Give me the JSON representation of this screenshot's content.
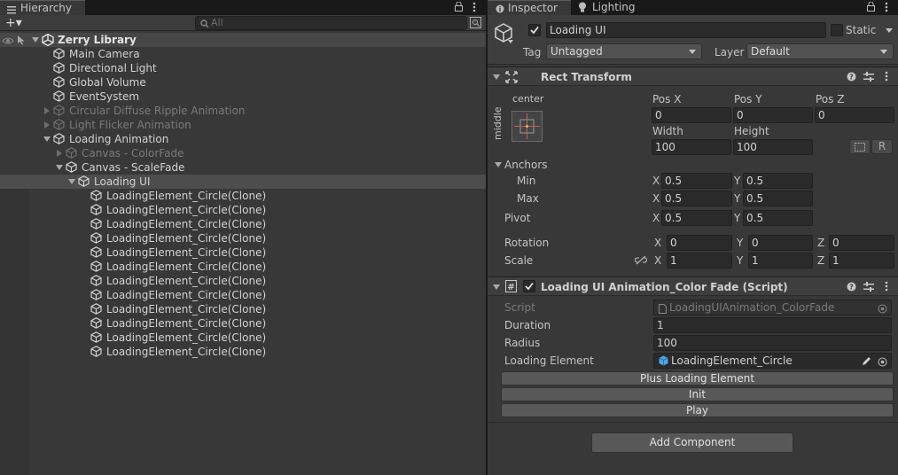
{
  "hierarchy": {
    "tab_label": "Hierarchy",
    "add_label": "+▾",
    "search_placeholder": "All",
    "scene_name": "Zerry Library",
    "items": [
      {
        "label": "Main Camera",
        "depth": 1,
        "dim": false,
        "arrow": "none"
      },
      {
        "label": "Directional Light",
        "depth": 1,
        "dim": false,
        "arrow": "none"
      },
      {
        "label": "Global Volume",
        "depth": 1,
        "dim": false,
        "arrow": "none"
      },
      {
        "label": "EventSystem",
        "depth": 1,
        "dim": false,
        "arrow": "none"
      },
      {
        "label": "Circular Diffuse Ripple Animation",
        "depth": 1,
        "dim": true,
        "arrow": "right"
      },
      {
        "label": "Light Flicker Animation",
        "depth": 1,
        "dim": true,
        "arrow": "right"
      },
      {
        "label": "Loading Animation",
        "depth": 1,
        "dim": false,
        "arrow": "down"
      },
      {
        "label": "Canvas - ColorFade",
        "depth": 2,
        "dim": true,
        "arrow": "right"
      },
      {
        "label": "Canvas - ScaleFade",
        "depth": 2,
        "dim": false,
        "arrow": "down"
      },
      {
        "label": "Loading UI",
        "depth": 3,
        "dim": false,
        "arrow": "down",
        "selected": true
      },
      {
        "label": "LoadingElement_Circle(Clone)",
        "depth": 4,
        "dim": false,
        "arrow": "none"
      },
      {
        "label": "LoadingElement_Circle(Clone)",
        "depth": 4,
        "dim": false,
        "arrow": "none"
      },
      {
        "label": "LoadingElement_Circle(Clone)",
        "depth": 4,
        "dim": false,
        "arrow": "none"
      },
      {
        "label": "LoadingElement_Circle(Clone)",
        "depth": 4,
        "dim": false,
        "arrow": "none"
      },
      {
        "label": "LoadingElement_Circle(Clone)",
        "depth": 4,
        "dim": false,
        "arrow": "none"
      },
      {
        "label": "LoadingElement_Circle(Clone)",
        "depth": 4,
        "dim": false,
        "arrow": "none"
      },
      {
        "label": "LoadingElement_Circle(Clone)",
        "depth": 4,
        "dim": false,
        "arrow": "none"
      },
      {
        "label": "LoadingElement_Circle(Clone)",
        "depth": 4,
        "dim": false,
        "arrow": "none"
      },
      {
        "label": "LoadingElement_Circle(Clone)",
        "depth": 4,
        "dim": false,
        "arrow": "none"
      },
      {
        "label": "LoadingElement_Circle(Clone)",
        "depth": 4,
        "dim": false,
        "arrow": "none"
      },
      {
        "label": "LoadingElement_Circle(Clone)",
        "depth": 4,
        "dim": false,
        "arrow": "none"
      },
      {
        "label": "LoadingElement_Circle(Clone)",
        "depth": 4,
        "dim": false,
        "arrow": "none"
      }
    ]
  },
  "inspector": {
    "tab_label": "Inspector",
    "lighting_tab_label": "Lighting",
    "object_name": "Loading UI",
    "static_label": "Static",
    "tag_label": "Tag",
    "tag_value": "Untagged",
    "layer_label": "Layer",
    "layer_value": "Default",
    "rect": {
      "title": "Rect Transform",
      "anchor_h": "center",
      "anchor_v": "middle",
      "pos_x_label": "Pos X",
      "pos_y_label": "Pos Y",
      "pos_z_label": "Pos Z",
      "pos_x": "0",
      "pos_y": "0",
      "pos_z": "0",
      "width_label": "Width",
      "height_label": "Height",
      "width": "100",
      "height": "100",
      "r_label": "R",
      "anchors_label": "Anchors",
      "min_label": "Min",
      "max_label": "Max",
      "min_x": "0.5",
      "min_y": "0.5",
      "max_x": "0.5",
      "max_y": "0.5",
      "pivot_label": "Pivot",
      "pivot_x": "0.5",
      "pivot_y": "0.5",
      "rotation_label": "Rotation",
      "rot_x": "0",
      "rot_y": "0",
      "rot_z": "0",
      "scale_label": "Scale",
      "scale_x": "1",
      "scale_y": "1",
      "scale_z": "1",
      "x_label": "X",
      "y_label": "Y",
      "z_label": "Z"
    },
    "script_comp": {
      "title": "Loading UI Animation_Color Fade (Script)",
      "script_label": "Script",
      "script_value": "LoadingUIAnimation_ColorFade",
      "duration_label": "Duration",
      "duration_value": "1",
      "radius_label": "Radius",
      "radius_value": "100",
      "element_label": "Loading Element",
      "element_value": "LoadingElement_Circle",
      "btn_plus": "Plus Loading Element",
      "btn_init": "Init",
      "btn_play": "Play"
    },
    "add_component": "Add Component"
  }
}
